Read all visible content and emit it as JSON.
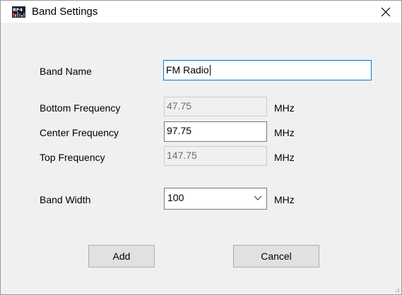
{
  "window": {
    "title": "Band Settings",
    "app_icon": "rf4-app-icon",
    "close_icon": "close-icon"
  },
  "form": {
    "band_name_label": "Band Name",
    "band_name_value": "FM Radio",
    "bottom_frequency_label": "Bottom Frequency",
    "bottom_frequency_value": "47.75",
    "bottom_frequency_unit": "MHz",
    "center_frequency_label": "Center Frequency",
    "center_frequency_value": "97.75",
    "center_frequency_unit": "MHz",
    "top_frequency_label": "Top Frequency",
    "top_frequency_value": "147.75",
    "top_frequency_unit": "MHz",
    "band_width_label": "Band Width",
    "band_width_value": "100",
    "band_width_unit": "MHz"
  },
  "buttons": {
    "add_label": "Add",
    "cancel_label": "Cancel"
  },
  "colors": {
    "dialog_background": "#f0f0f0",
    "titlebar_background": "#ffffff",
    "focus_border": "#0078d7",
    "button_face": "#e1e1e1",
    "disabled_text": "#6d6d6d"
  }
}
